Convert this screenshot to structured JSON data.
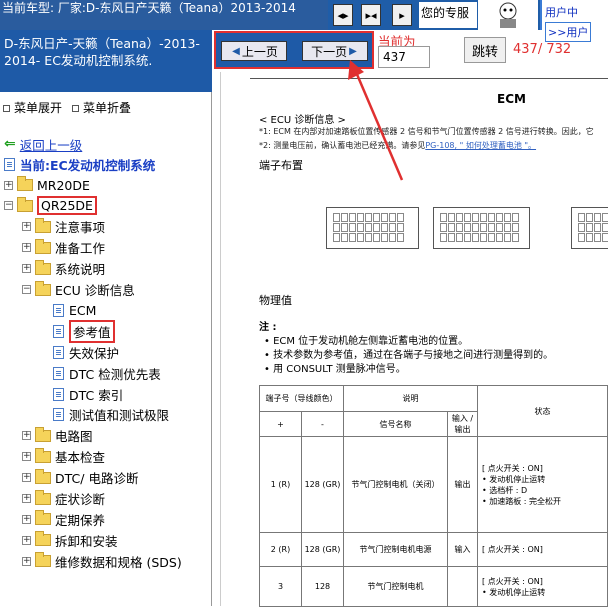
{
  "header": {
    "title": "当前车型:  厂家:D-东风日产天籁（Teana）2013-2014",
    "nav_buttons": [
      "◆",
      "◆◆",
      "◆"
    ],
    "recommend": "您的专服",
    "user_center_line1": "用户中",
    "user_center_link": ">>用户",
    "colors": {
      "bar": "#1f5da8",
      "accent_red": "#e03030",
      "link_blue": "#1a3fc4"
    }
  },
  "sidebar": {
    "title": "D-东风日产-天籁（Teana）-2013-2014- EC发动机控制系统.",
    "expand_label": "菜单展开",
    "collapse_label": "菜单折叠",
    "back_label": "返回上一级",
    "current_label": "当前:EC发动机控制系统",
    "items": [
      {
        "label": "MR20DE",
        "type": "folder",
        "level": 0
      },
      {
        "label": "QR25DE",
        "type": "folder",
        "level": 0,
        "highlight": true,
        "expanded": true
      },
      {
        "label": "注意事项",
        "type": "folder",
        "level": 1
      },
      {
        "label": "准备工作",
        "type": "folder",
        "level": 1
      },
      {
        "label": "系统说明",
        "type": "folder",
        "level": 1
      },
      {
        "label": "ECU 诊断信息",
        "type": "folder",
        "level": 1,
        "expanded": true
      },
      {
        "label": "ECM",
        "type": "page",
        "level": 2
      },
      {
        "label": "参考值",
        "type": "page",
        "level": 2,
        "highlight": true
      },
      {
        "label": "失效保护",
        "type": "page",
        "level": 2
      },
      {
        "label": "DTC 检测优先表",
        "type": "page",
        "level": 2
      },
      {
        "label": "DTC 索引",
        "type": "page",
        "level": 2
      },
      {
        "label": "测试值和测试极限",
        "type": "page",
        "level": 2
      },
      {
        "label": "电路图",
        "type": "folder",
        "level": 1
      },
      {
        "label": "基本检查",
        "type": "folder",
        "level": 1
      },
      {
        "label": "DTC/ 电路诊断",
        "type": "folder",
        "level": 1
      },
      {
        "label": "症状诊断",
        "type": "folder",
        "level": 1
      },
      {
        "label": "定期保养",
        "type": "folder",
        "level": 1
      },
      {
        "label": "拆卸和安装",
        "type": "folder",
        "level": 1
      },
      {
        "label": "维修数据和规格 (SDS)",
        "type": "folder",
        "level": 1
      }
    ]
  },
  "pager": {
    "prev_label": "上一页",
    "next_label": "下一页",
    "current_label": "当前为",
    "page_value": "437",
    "jump_label": "跳转",
    "page_count": "437/ 732"
  },
  "document": {
    "title": "ECM",
    "section_head": "< ECU 诊断信息 >",
    "note1": "*1: ECM 在内部对加速踏板位置传感器 2 信号和节气门位置传感器 2 信号进行转换。因此，它",
    "note2_prefix": "*2: 测量电压前，确认蓄电池已经充满。请参见",
    "note2_link": "PG-108, \" 如何处理蓄电池 \"。",
    "terminal_layout": "端子布置",
    "physical_values": "物理值",
    "notes_title": "注 :",
    "bullets": [
      "• ECM 位于发动机舱左侧靠近蓄电池的位置。",
      "• 技术参数为参考值，通过在各端子与接地之间进行测量得到的。",
      "• 用 CONSULT 测量脉冲信号。"
    ],
    "table": {
      "h_terminal": "端子号（导线颜色）",
      "h_desc": "说明",
      "h_state": "状态",
      "h_plus": "+",
      "h_minus": "-",
      "h_signal": "信号名称",
      "h_io": "输入 / 输出",
      "rows": [
        {
          "plus": "1 (R)",
          "minus": "128 (GR)",
          "signal": "节气门控制电机（关闭）",
          "io": "输出",
          "state": "[ 点火开关 : ON]\n• 发动机停止运转\n• 选档杆 : D\n• 加速踏板 : 完全松开"
        },
        {
          "plus": "2 (R)",
          "minus": "128 (GR)",
          "signal": "节气门控制电机电源",
          "io": "输入",
          "state": "[ 点火开关 : ON]"
        },
        {
          "plus": "3",
          "minus": "128",
          "signal": "节气门控制电机",
          "io": "",
          "state": "[ 点火开关 : ON]\n• 发动机停止运转"
        }
      ]
    }
  }
}
